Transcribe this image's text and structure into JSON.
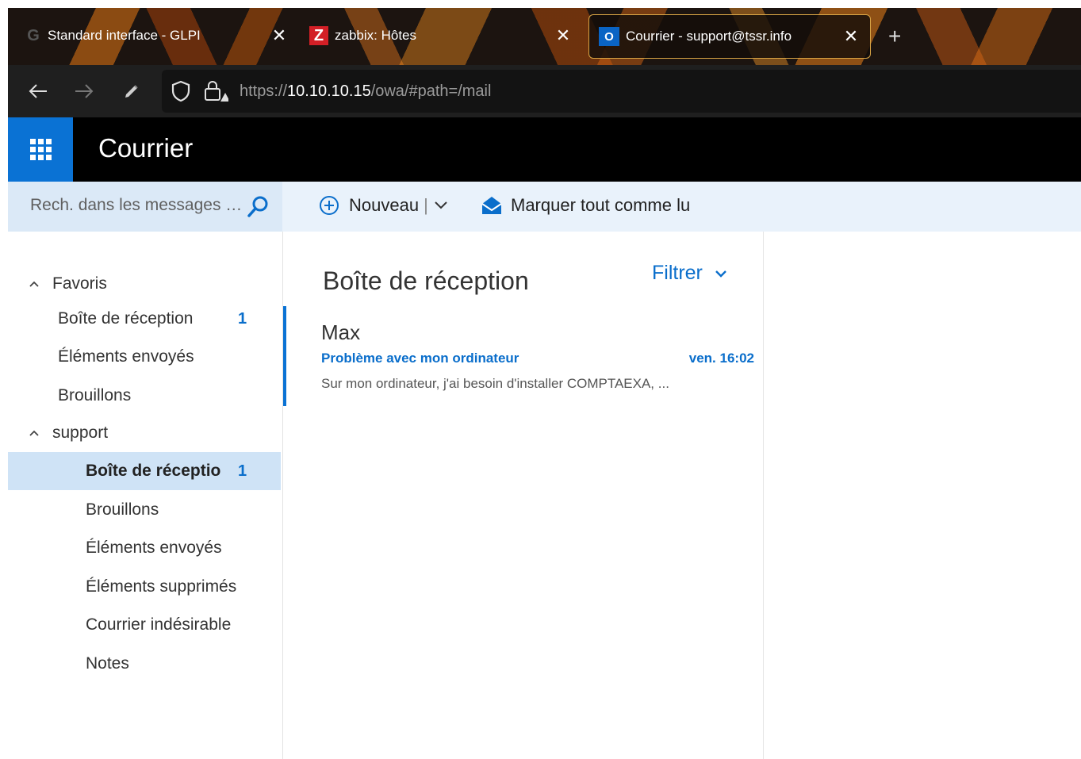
{
  "browser": {
    "tabs": [
      {
        "favicon": "G",
        "title": "Standard interface - GLPI"
      },
      {
        "favicon": "Z",
        "title": "zabbix: Hôtes"
      },
      {
        "favicon": "O",
        "title": "Courrier - support@tssr.info"
      }
    ],
    "close_glyph": "✕",
    "new_tab_glyph": "+",
    "url": {
      "scheme": "https://",
      "host": "10.10.10.15",
      "path": "/owa/#path=/mail"
    }
  },
  "app": {
    "title": "Courrier"
  },
  "search": {
    "placeholder": "Rech. dans les messages e..."
  },
  "commands": {
    "new_label": "Nouveau",
    "separator": "|",
    "mark_all_read_label": "Marquer tout comme lu"
  },
  "folders": {
    "favorites_label": "Favoris",
    "favorites": [
      {
        "label": "Boîte de réception",
        "count": "1"
      },
      {
        "label": "Éléments envoyés",
        "count": ""
      },
      {
        "label": "Brouillons",
        "count": ""
      }
    ],
    "account_label": "support",
    "account_items": [
      {
        "label": "Boîte de réceptio",
        "count": "1"
      },
      {
        "label": "Brouillons",
        "count": ""
      },
      {
        "label": "Éléments envoyés",
        "count": ""
      },
      {
        "label": "Éléments supprimés",
        "count": ""
      },
      {
        "label": "Courrier indésirable",
        "count": ""
      },
      {
        "label": "Notes",
        "count": ""
      }
    ]
  },
  "message_list": {
    "title": "Boîte de réception",
    "filter_label": "Filtrer",
    "messages": [
      {
        "from": "Max",
        "subject": "Problème avec mon ordinateur",
        "time": "ven. 16:02",
        "preview": "Sur mon ordinateur, j'ai besoin d'installer COMPTAEXA, ..."
      }
    ]
  },
  "colors": {
    "accent": "#0a72d4",
    "link": "#0a6ecb",
    "selected_folder_bg": "#cfe3f6",
    "search_bg": "#dbe9f7"
  }
}
